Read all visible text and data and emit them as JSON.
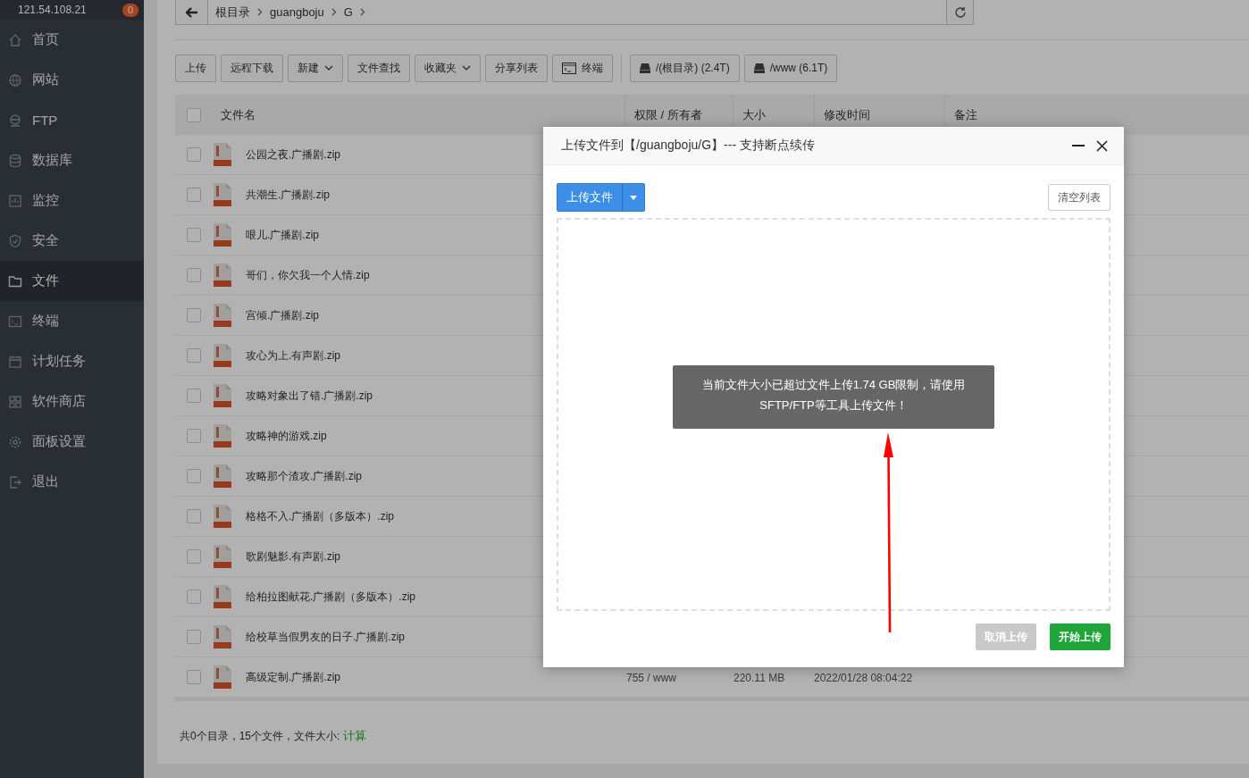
{
  "sidebar": {
    "server": "121.54.108.21",
    "badge": "0",
    "items": [
      {
        "label": "首页",
        "selected": false
      },
      {
        "label": "网站",
        "selected": false
      },
      {
        "label": "FTP",
        "selected": false
      },
      {
        "label": "数据库",
        "selected": false
      },
      {
        "label": "监控",
        "selected": false
      },
      {
        "label": "安全",
        "selected": false
      },
      {
        "label": "文件",
        "selected": true
      },
      {
        "label": "终端",
        "selected": false
      },
      {
        "label": "计划任务",
        "selected": false
      },
      {
        "label": "软件商店",
        "selected": false
      },
      {
        "label": "面板设置",
        "selected": false
      },
      {
        "label": "退出",
        "selected": false
      }
    ]
  },
  "breadcrumb": [
    "根目录",
    "guangboju",
    "G"
  ],
  "toolbar": [
    {
      "label": "上传",
      "kind": "plain"
    },
    {
      "label": "远程下载",
      "kind": "plain"
    },
    {
      "label": "新建",
      "kind": "dropdown"
    },
    {
      "label": "文件查找",
      "kind": "plain"
    },
    {
      "label": "收藏夹",
      "kind": "dropdown"
    },
    {
      "label": "分享列表",
      "kind": "plain"
    },
    {
      "label": "终端",
      "kind": "terminal"
    }
  ],
  "disks": [
    "/(根目录) (2.4T)",
    "/www (6.1T)"
  ],
  "table": {
    "columns": [
      "文件名",
      "权限 / 所有者",
      "大小",
      "修改时间",
      "备注"
    ],
    "header_checked": false,
    "rows": [
      {
        "name": "公园之夜.广播剧.zip",
        "checked": false
      },
      {
        "name": "共潮生.广播剧.zip",
        "checked": false
      },
      {
        "name": "哏儿.广播剧.zip",
        "checked": false
      },
      {
        "name": "哥们，你欠我一个人情.zip",
        "checked": false
      },
      {
        "name": "宫倾.广播剧.zip",
        "checked": false
      },
      {
        "name": "攻心为上.有声剧.zip",
        "checked": false
      },
      {
        "name": "攻略对象出了错.广播剧.zip",
        "checked": false
      },
      {
        "name": "攻略神的游戏.zip",
        "checked": false
      },
      {
        "name": "攻略那个渣攻.广播剧.zip",
        "checked": false
      },
      {
        "name": "格格不入.广播剧（多版本）.zip",
        "checked": false
      },
      {
        "name": "歌剧魅影.有声剧.zip",
        "checked": false
      },
      {
        "name": "给柏拉图献花.广播剧（多版本）.zip",
        "checked": false
      },
      {
        "name": "给校草当假男友的日子.广播剧.zip",
        "checked": false
      },
      {
        "name": "高级定制.广播剧.zip",
        "checked": false,
        "permissions": "755 / www",
        "size": "220.11 MB",
        "modified": "2022/01/28 08:04:22"
      }
    ]
  },
  "footer": {
    "summary": "共0个目录，15个文件，文件大小: ",
    "link": "计算"
  },
  "dialog": {
    "title": "上传文件到【/guangboju/G】--- 支持断点续传",
    "upload_button": "上传文件",
    "clear_button": "清空列表",
    "toast": "当前文件大小已超过文件上传1.74 GB限制，请使用SFTP/FTP等工具上传文件！",
    "buttons": [
      {
        "label": "取消上传",
        "disabled": true
      },
      {
        "label": "开始上传",
        "disabled": false
      }
    ]
  }
}
